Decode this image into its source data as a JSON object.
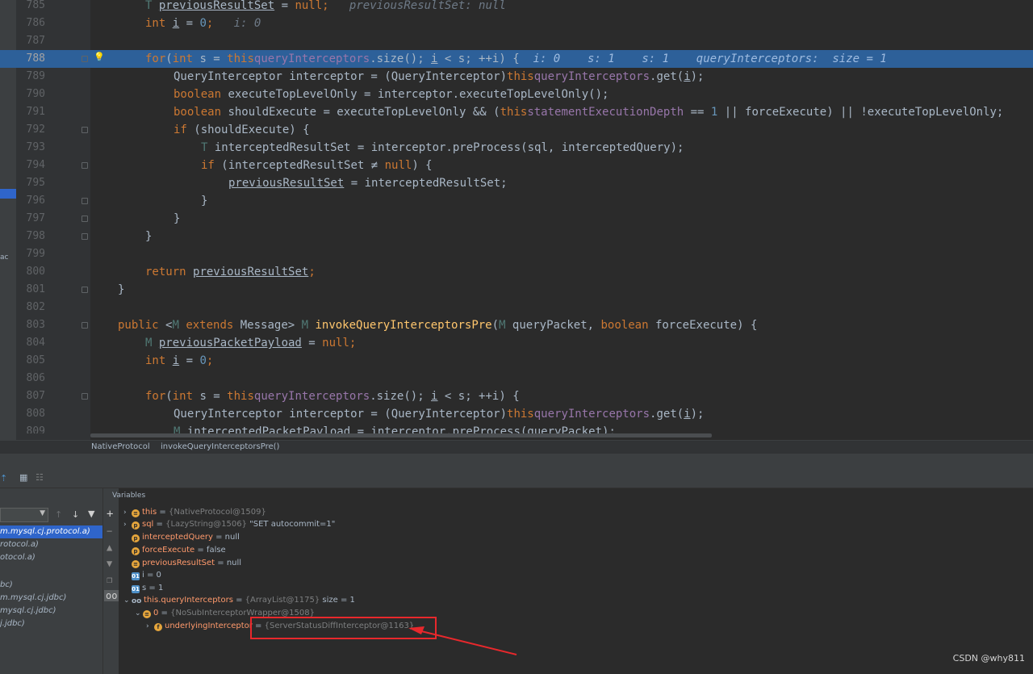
{
  "editor": {
    "current_line": "788",
    "lines": [
      {
        "n": "785"
      },
      {
        "n": "786"
      },
      {
        "n": "787"
      },
      {
        "n": "788"
      },
      {
        "n": "789"
      },
      {
        "n": "790"
      },
      {
        "n": "791"
      },
      {
        "n": "792"
      },
      {
        "n": "793"
      },
      {
        "n": "794"
      },
      {
        "n": "795"
      },
      {
        "n": "796"
      },
      {
        "n": "797"
      },
      {
        "n": "798"
      },
      {
        "n": "799"
      },
      {
        "n": "800"
      },
      {
        "n": "801"
      },
      {
        "n": "802"
      },
      {
        "n": "803"
      },
      {
        "n": "804"
      },
      {
        "n": "805"
      },
      {
        "n": "806"
      },
      {
        "n": "807"
      },
      {
        "n": "808"
      },
      {
        "n": "809"
      }
    ],
    "code": {
      "l785": {
        "t1": "T ",
        "v1": "previousResultSet",
        "t2": " = ",
        "k1": "null",
        ";": ";",
        "hint": "previousResultSet: null"
      },
      "l786": {
        "k1": "int ",
        "v1": "i",
        "t1": " = ",
        "n1": "0",
        ";": ";",
        "hint": "i: 0"
      },
      "l788": {
        "k1": "for",
        "t1": "(",
        "k2": "int ",
        "t2": "s = ",
        "k3": "this",
        ".": ".",
        "f1": "queryInterceptors",
        "t3": ".size(); ",
        "v1": "i",
        "t4": " < s; ++",
        "v2": "i",
        "t5": ") {",
        "hint": "i: 0    s: 1    s: 1    queryInterceptors:  size = 1"
      },
      "l789": {
        "t1": "QueryInterceptor interceptor = (QueryInterceptor)",
        "k1": "this",
        ".": ".",
        "f1": "queryInterceptors",
        "t2": ".get(",
        "v1": "i",
        "t3": ");"
      },
      "l790": {
        "k1": "boolean ",
        "t1": "executeTopLevelOnly = interceptor.executeTopLevelOnly();"
      },
      "l791": {
        "k1": "boolean ",
        "t1": "shouldExecute = executeTopLevelOnly && (",
        "k2": "this",
        ".": ".",
        "f1": "statementExecutionDepth",
        "t2": " == ",
        "n1": "1",
        "t3": " || forceExecute) || !executeTopLevelOnly;"
      },
      "l792": {
        "k1": "if ",
        "t1": "(shouldExecute) {"
      },
      "l793": {
        "tp": "T ",
        "t1": "interceptedResultSet = interceptor.preProcess(sql, interceptedQuery);"
      },
      "l794": {
        "k1": "if ",
        "t1": "(interceptedResultSet ≠ ",
        "k2": "null",
        "t2": ") {"
      },
      "l795": {
        "v1": "previousResultSet",
        "t1": " = interceptedResultSet;"
      },
      "l796": {
        "t1": "}"
      },
      "l797": {
        "t1": "}"
      },
      "l798": {
        "t1": "}"
      },
      "l800": {
        "k1": "return ",
        "v1": "previousResultSet",
        ";": ";"
      },
      "l801": {
        "t1": "}"
      },
      "l803": {
        "k1": "public ",
        "t1": "<",
        "tp1": "M ",
        "k2": "extends ",
        "t2": "Message> ",
        "tp2": "M ",
        "f1": "invokeQueryInterceptorsPre",
        "t3": "(",
        "tp3": "M ",
        "t4": "queryPacket, ",
        "k3": "boolean ",
        "t5": "forceExecute) {"
      },
      "l804": {
        "tp": "M ",
        "v1": "previousPacketPayload",
        "t1": " = ",
        "k1": "null",
        ";": ";"
      },
      "l805": {
        "k1": "int ",
        "v1": "i",
        "t1": " = ",
        "n1": "0",
        ";": ";"
      },
      "l807": {
        "k1": "for",
        "t1": "(",
        "k2": "int ",
        "t2": "s = ",
        "k3": "this",
        ".": ".",
        "f1": "queryInterceptors",
        "t3": ".size(); ",
        "v1": "i",
        "t4": " < s; ++",
        "v2": "i",
        "t5": ") {"
      },
      "l808": {
        "t1": "QueryInterceptor interceptor = (QueryInterceptor)",
        "k1": "this",
        ".": ".",
        "f1": "queryInterceptors",
        "t2": ".get(",
        "v1": "i",
        "t3": ");"
      },
      "l809": {
        "tp": "M ",
        "t1": "interceptedPacketPayload = interceptor.preProcess(queryPacket);"
      }
    }
  },
  "left_strip": {
    "label1": "ac",
    "label2": "a"
  },
  "breadcrumb": {
    "class": "NativeProtocol",
    "method": "invokeQueryInterceptorsPre()"
  },
  "frames": {
    "rows": [
      "m.mysql.cj.protocol.a)",
      "rotocol.a)",
      "otocol.a)",
      "",
      "bc)",
      "m.mysql.cj.jdbc)",
      "mysql.cj.jdbc)",
      "j.jdbc)"
    ]
  },
  "variables": {
    "title": "Variables",
    "items": [
      {
        "name": "this",
        "eq": " = ",
        "type": "{NativeProtocol@1509}",
        "val": ""
      },
      {
        "name": "sql",
        "eq": " = ",
        "type": "{LazyString@1506}",
        "val": " \"SET autocommit=1\""
      },
      {
        "name": "interceptedQuery",
        "eq": " = ",
        "type": "",
        "val": "null"
      },
      {
        "name": "forceExecute",
        "eq": " = ",
        "type": "",
        "val": "false"
      },
      {
        "name": "previousResultSet",
        "eq": " = ",
        "type": "",
        "val": "null"
      },
      {
        "name": "i",
        "eq": " = ",
        "type": "",
        "val": "0"
      },
      {
        "name": "s",
        "eq": " = ",
        "type": "",
        "val": "1"
      },
      {
        "name": "this.queryInterceptors",
        "eq": " = ",
        "type": "{ArrayList@1175}",
        "val": "  size = 1"
      },
      {
        "name": "0",
        "eq": " = ",
        "type": "{NoSubInterceptorWrapper@1508}",
        "val": ""
      },
      {
        "name": "underlyingInterceptor",
        "eq": " = ",
        "type": "{ServerStatusDiffInterceptor@1163}",
        "val": ""
      }
    ]
  },
  "watermark": "CSDN @why811",
  "colors": {
    "annotation": "#e8282c",
    "selection": "#2d6099"
  }
}
